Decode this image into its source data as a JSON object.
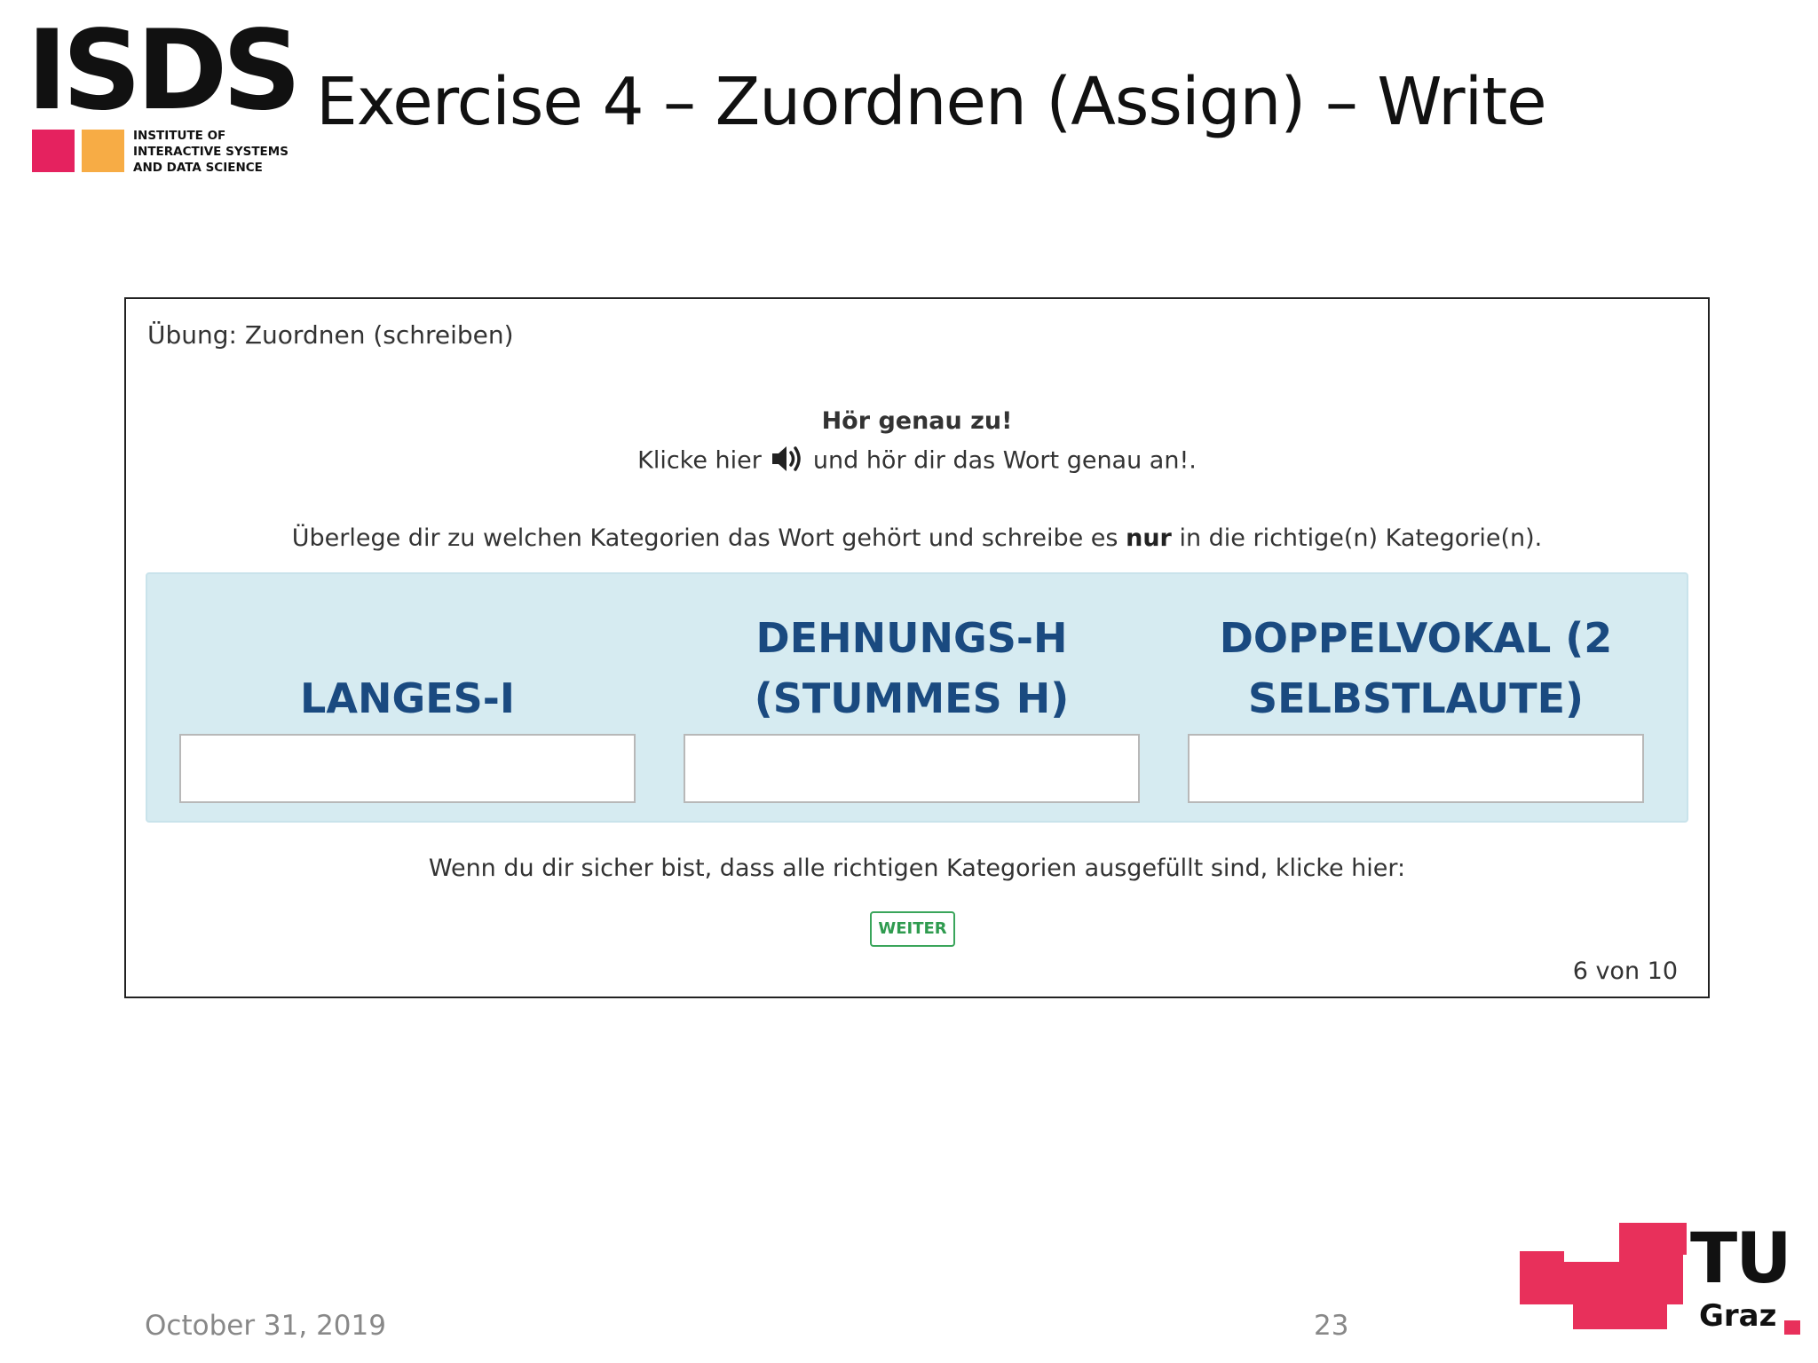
{
  "header": {
    "logo": {
      "wordmark": "ISDS",
      "subtitle_lines": [
        "INSTITUTE OF",
        "INTERACTIVE SYSTEMS",
        "AND DATA SCIENCE"
      ],
      "square_colors": [
        "#e5225f",
        "#f7ac45"
      ]
    },
    "title": "Exercise 4 – Zuordnen (Assign) – Write"
  },
  "exercise": {
    "title": "Übung: Zuordnen (schreiben)",
    "listen_heading": "Hör genau zu!",
    "listen_before": "Klicke hier",
    "listen_icon": "speaker-icon",
    "listen_after": "und hör dir das Wort genau an!.",
    "instruction_before": "Überlege dir zu welchen Kategorien das Wort gehört und schreibe es",
    "instruction_bold": "nur",
    "instruction_after": "in die richtige(n) Kategorie(n).",
    "categories": [
      {
        "label": "LANGES-I",
        "value": ""
      },
      {
        "label": "DEHNUNGS-H (STUMMES H)",
        "value": ""
      },
      {
        "label": "DOPPELVOKAL (2 SELBSTLAUTE)",
        "value": ""
      }
    ],
    "confirm_text": "Wenn du dir sicher bist, dass alle richtigen Kategorien ausgefüllt sind, klicke hier:",
    "next_button": "WEITER",
    "progress": "6 von 10",
    "colors": {
      "panel_bg": "#d6ebf1",
      "category_label": "#1a4a80",
      "button_green": "#3aa55b"
    }
  },
  "footer": {
    "date": "October 31, 2019",
    "page_number": "23",
    "tu_logo": {
      "line1": "TU",
      "line2": "Graz",
      "color": "#e8305b"
    }
  }
}
